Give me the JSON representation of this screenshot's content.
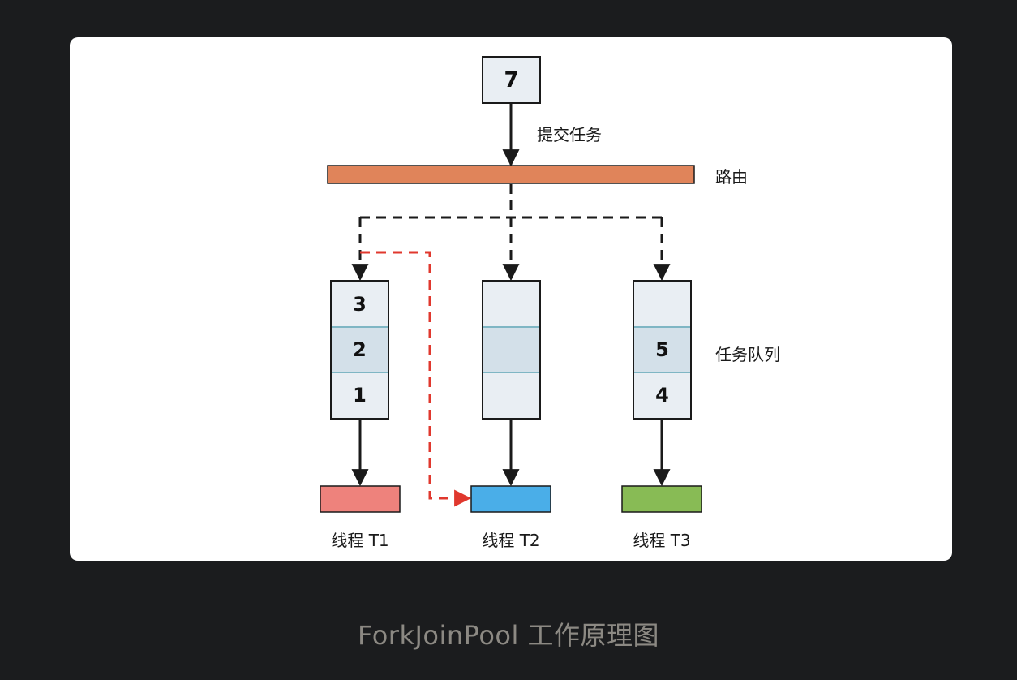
{
  "diagram": {
    "top_task": {
      "label": "7"
    },
    "submit_label": "提交任务",
    "route_label": "路由",
    "queue_label": "任务队列",
    "queues": [
      {
        "cells": [
          "3",
          "2",
          "1"
        ]
      },
      {
        "cells": [
          "",
          "",
          ""
        ]
      },
      {
        "cells": [
          "",
          "5",
          "4"
        ]
      }
    ],
    "threads": [
      {
        "label": "线程 T1",
        "color": "#ee827c"
      },
      {
        "label": "线程 T2",
        "color": "#4aaee8"
      },
      {
        "label": "线程 T3",
        "color": "#88bb55"
      }
    ],
    "router_color": "#e0845a",
    "steal_arrow_color": "#e0382e"
  },
  "caption": "ForkJoinPool 工作原理图"
}
